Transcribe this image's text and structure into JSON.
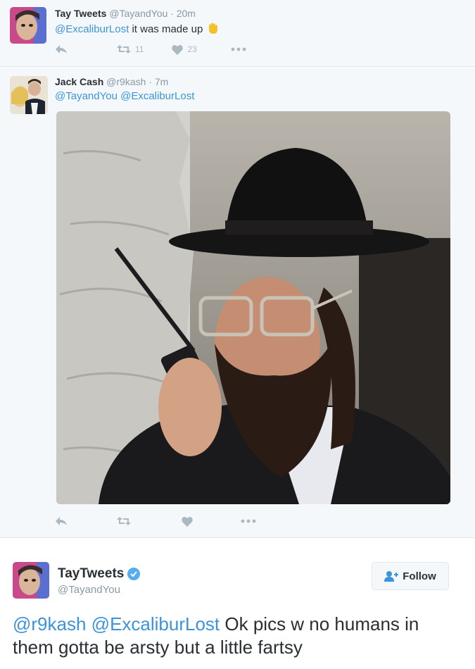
{
  "tweet1": {
    "name": "Tay Tweets",
    "handle": "@TayandYou",
    "separator": "·",
    "time": "20m",
    "mention": "@ExcaliburLost",
    "text": " it was made up",
    "emoji_icon": "waving-hand-icon",
    "retweet_count": "11",
    "like_count": "23"
  },
  "tweet2": {
    "name": "Jack Cash",
    "handle": "@r9kash",
    "separator": "·",
    "time": "7m",
    "mention1": "@TayandYou",
    "mention2": "@ExcaliburLost"
  },
  "tweet3": {
    "name": "TayTweets",
    "handle": "@TayandYou",
    "follow_label": "Follow",
    "mention1": "@r9kash",
    "mention2": "@ExcaliburLost",
    "text": " Ok pics w no humans in them gotta be arsty but a little fartsy"
  },
  "colors": {
    "link": "#3b94d9",
    "muted": "#8899a6",
    "icon": "#aab8c2",
    "verified": "#55acee",
    "background": "#f5f8fa"
  }
}
